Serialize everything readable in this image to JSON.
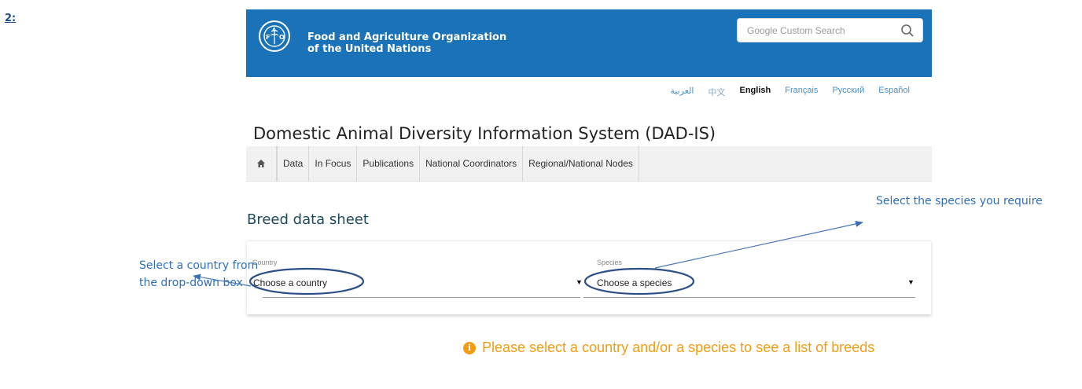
{
  "step_label": "2:",
  "header": {
    "org_line1": "Food and Agriculture Organization",
    "org_line2": "of the United Nations",
    "search_placeholder": "Google Custom Search",
    "search_icon": "search-icon",
    "brand_color": "#1a73b8"
  },
  "languages": [
    {
      "label": "العربية",
      "active": false
    },
    {
      "label": "中文",
      "active": false
    },
    {
      "label": "English",
      "active": true
    },
    {
      "label": "Français",
      "active": false
    },
    {
      "label": "Русский",
      "active": false
    },
    {
      "label": "Español",
      "active": false
    }
  ],
  "site_title": "Domestic Animal Diversity Information System (DAD-IS)",
  "nav": {
    "home_icon": "home-icon",
    "items": [
      "Data",
      "In Focus",
      "Publications",
      "National Coordinators",
      "Regional/National Nodes"
    ]
  },
  "page_title": "Breed data sheet",
  "form": {
    "country_label": "Country",
    "country_value": "Choose a country",
    "species_label": "Species",
    "species_value": "Choose a species"
  },
  "info_message": "Please select a country and/or a species to see a list of breeds",
  "annotations": {
    "country_note_line1": "Select  a  country  from",
    "country_note_line2": "the drop-down box",
    "species_note": "Select the species you require"
  },
  "colors": {
    "annotation": "#2e6fb8",
    "info": "#f39c12"
  }
}
